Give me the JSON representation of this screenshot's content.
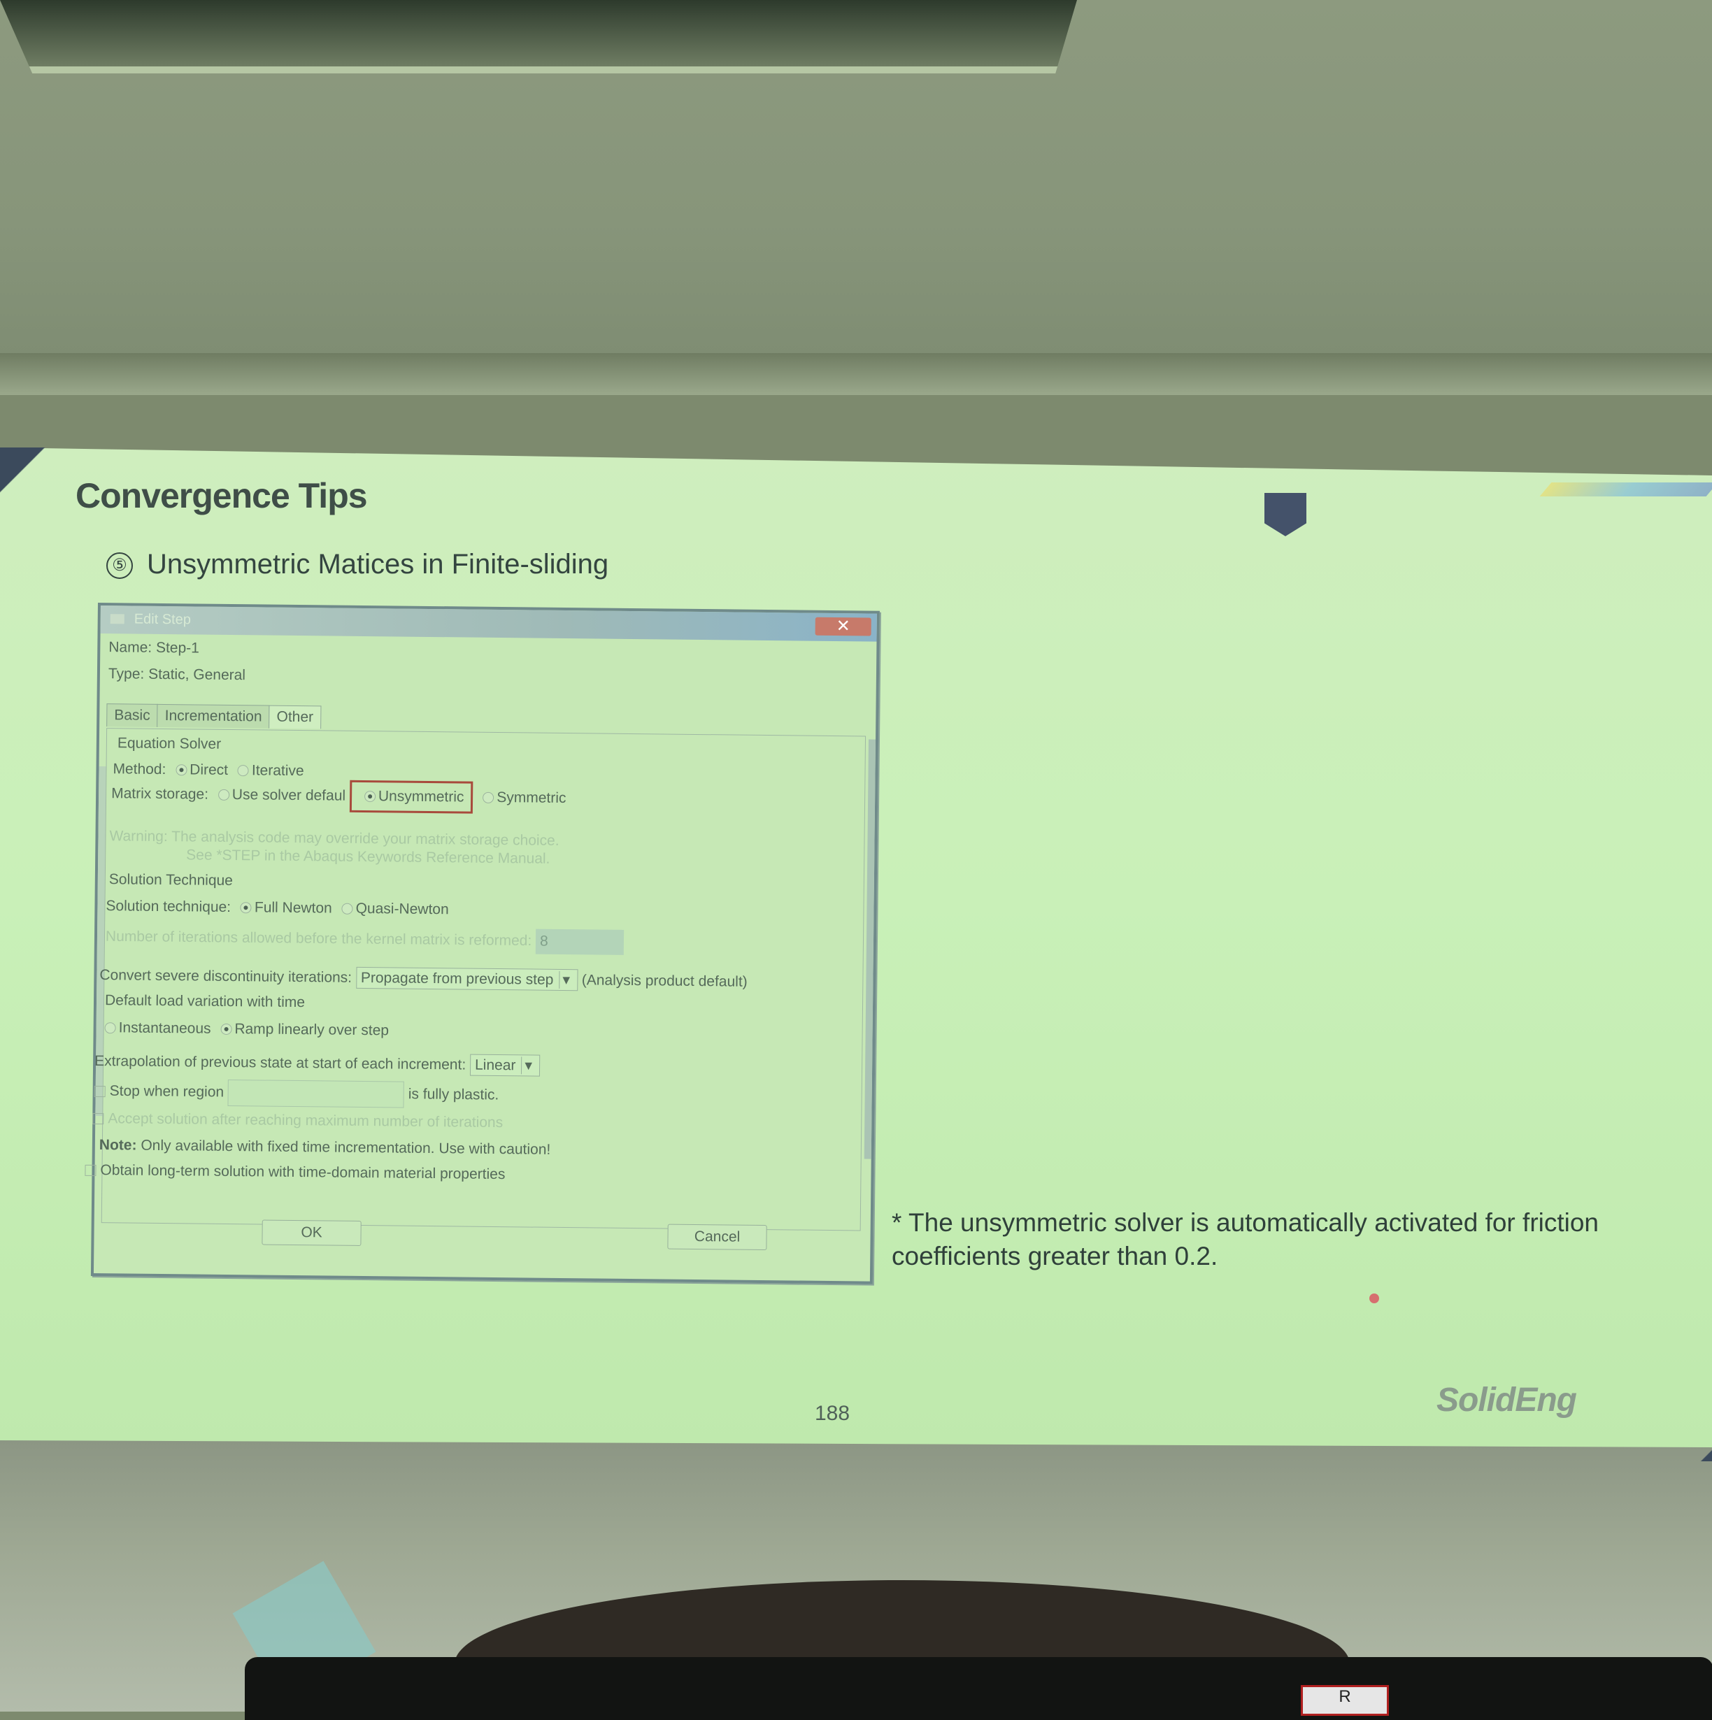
{
  "slide": {
    "title": "Convergence Tips",
    "section_number": "⑤",
    "subtitle": "Unsymmetric Matices in Finite-sliding",
    "footnote": "* The unsymmetric solver is automatically activated for friction coefficients greater than 0.2.",
    "page_number": "188",
    "logo": "SolidEng"
  },
  "dialog": {
    "title": "Edit Step",
    "close_glyph": "✕",
    "name_label": "Name:",
    "name_value": "Step-1",
    "type_label": "Type:",
    "type_value": "Static, General",
    "tabs": [
      "Basic",
      "Incrementation",
      "Other"
    ],
    "active_tab": "Other",
    "equation_solver": {
      "heading": "Equation Solver",
      "method_label": "Method:",
      "method_options": [
        "Direct",
        "Iterative"
      ],
      "method_selected": "Direct",
      "matrix_label": "Matrix storage:",
      "matrix_options": [
        "Use solver default",
        "Unsymmetric",
        "Symmetric"
      ],
      "matrix_option_1_visible": "Use solver defaul",
      "matrix_selected": "Unsymmetric",
      "warning_label": "Warning:",
      "warning_line1": "The analysis code may override your matrix storage choice.",
      "warning_line2": "See *STEP in the Abaqus Keywords Reference Manual."
    },
    "solution_technique": {
      "heading": "Solution Technique",
      "label": "Solution technique:",
      "options": [
        "Full Newton",
        "Quasi-Newton"
      ],
      "selected": "Full Newton",
      "reform_label": "Number of iterations allowed before the kernel matrix is reformed:",
      "reform_value": "8"
    },
    "discontinuity_label": "Convert severe discontinuity iterations:",
    "discontinuity_value": "Propagate from previous step",
    "discontinuity_note": "(Analysis product default)",
    "load_variation": {
      "heading": "Default load variation with time",
      "options": [
        "Instantaneous",
        "Ramp linearly over step"
      ],
      "selected": "Ramp linearly over step"
    },
    "extrapolation_label": "Extrapolation of previous state at start of each increment:",
    "extrapolation_value": "Linear",
    "stop_region_label": "Stop when region",
    "stop_region_suffix": "is fully plastic.",
    "accept_solution_label": "Accept solution after reaching maximum number of iterations",
    "note_label": "Note:",
    "note_text": "Only available with fixed time incrementation. Use with caution!",
    "long_term_label": "Obtain long-term solution with time-domain material properties",
    "ok_label": "OK",
    "cancel_label": "Cancel"
  },
  "sticker_text": "R"
}
